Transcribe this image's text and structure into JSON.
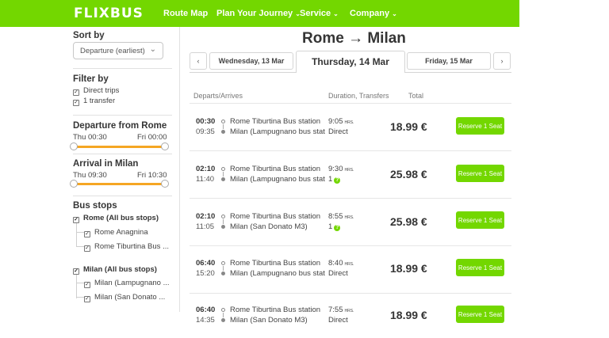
{
  "header": {
    "logo": "FLIXBUS",
    "nav": [
      {
        "label": "Route Map",
        "dropdown": false
      },
      {
        "label": "Plan Your Journey",
        "dropdown": true
      },
      {
        "label": "Service",
        "dropdown": true
      },
      {
        "label": "Company",
        "dropdown": true
      }
    ],
    "brand_color": "#73d700"
  },
  "sidebar": {
    "sort_title": "Sort by",
    "sort_value": "Departure (earliest)",
    "filter_title": "Filter by",
    "filters": [
      {
        "label": "Direct trips",
        "checked": true
      },
      {
        "label": "1 transfer",
        "checked": true
      }
    ],
    "departure": {
      "title": "Departure from Rome",
      "min": "Thu 00:30",
      "max": "Fri 00:00"
    },
    "arrival": {
      "title": "Arrival in Milan",
      "min": "Thu 09:30",
      "max": "Fri 10:30"
    },
    "bus_stops_title": "Bus stops",
    "stop_groups": [
      {
        "label": "Rome (All bus stops)",
        "checked": true,
        "items": [
          "Rome Anagnina",
          "Rome Tiburtina Bus ..."
        ]
      },
      {
        "label": "Milan (All bus stops)",
        "checked": true,
        "items": [
          "Milan (Lampugnano ...",
          "Milan (San Donato ..."
        ]
      }
    ]
  },
  "main": {
    "title": "Rome → Milan",
    "prev_arrow": "‹",
    "next_arrow": "›",
    "dates": {
      "prev": "Wednesday, 13 Mar",
      "current": "Thursday, 14 Mar",
      "next": "Friday, 15 Mar"
    },
    "columns": {
      "departs": "Departs/Arrives",
      "duration": "Duration, Transfers",
      "total": "Total"
    },
    "trips": [
      {
        "dep": "00:30",
        "arr": "09:35",
        "from": "Rome Tiburtina Bus station",
        "to": "Milan (Lampugnano bus stat...",
        "duration": "9:05",
        "unit": "HRS.",
        "transfers": "Direct",
        "transfer_help": false,
        "price": "18.99 €",
        "button": "Reserve 1 Seat"
      },
      {
        "dep": "02:10",
        "arr": "11:40",
        "from": "Rome Tiburtina Bus station",
        "to": "Milan (Lampugnano bus stat...",
        "duration": "9:30",
        "unit": "HRS.",
        "transfers": "1",
        "transfer_help": true,
        "price": "25.98 €",
        "button": "Reserve 1 Seat"
      },
      {
        "dep": "02:10",
        "arr": "11:05",
        "from": "Rome Tiburtina Bus station",
        "to": "Milan (San Donato M3)",
        "duration": "8:55",
        "unit": "HRS.",
        "transfers": "1",
        "transfer_help": true,
        "price": "25.98 €",
        "button": "Reserve 1 Seat"
      },
      {
        "dep": "06:40",
        "arr": "15:20",
        "from": "Rome Tiburtina Bus station",
        "to": "Milan (Lampugnano bus stat...",
        "duration": "8:40",
        "unit": "HRS.",
        "transfers": "Direct",
        "transfer_help": false,
        "price": "18.99 €",
        "button": "Reserve 1 Seat"
      },
      {
        "dep": "06:40",
        "arr": "14:35",
        "from": "Rome Tiburtina Bus station",
        "to": "Milan (San Donato M3)",
        "duration": "7:55",
        "unit": "HRS.",
        "transfers": "Direct",
        "transfer_help": false,
        "price": "18.99 €",
        "button": "Reserve 1 Seat"
      }
    ]
  }
}
